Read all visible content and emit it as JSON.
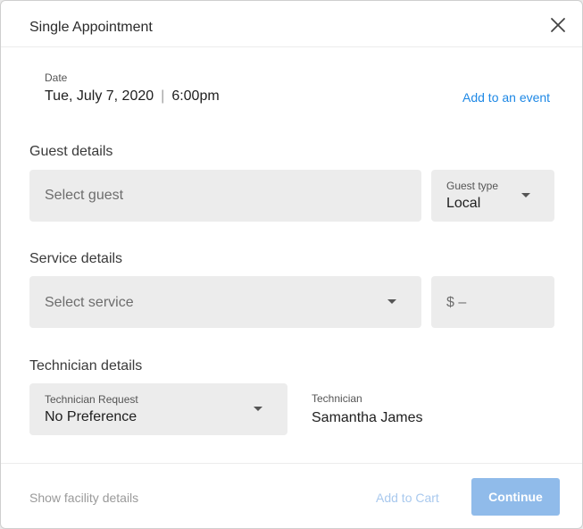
{
  "dialog": {
    "title": "Single Appointment",
    "close_icon": "close-icon"
  },
  "date": {
    "label": "Date",
    "day": "Tue, July 7, 2020",
    "separator": "|",
    "time": "6:00pm",
    "add_event_label": "Add to an event"
  },
  "guest": {
    "section_title": "Guest details",
    "select_placeholder": "Select guest",
    "type_label": "Guest type",
    "type_value": "Local"
  },
  "service": {
    "section_title": "Service details",
    "select_placeholder": "Select service",
    "price_placeholder": "$ –"
  },
  "technician": {
    "section_title": "Technician details",
    "request_label": "Technician Request",
    "request_value": "No Preference",
    "tech_label": "Technician",
    "tech_value": "Samantha James"
  },
  "footer": {
    "facility_link": "Show facility details",
    "add_cart_label": "Add to Cart",
    "continue_label": "Continue"
  },
  "colors": {
    "accent": "#1e88e5",
    "primary_disabled": "#90bbea",
    "field_bg": "#ececec"
  }
}
